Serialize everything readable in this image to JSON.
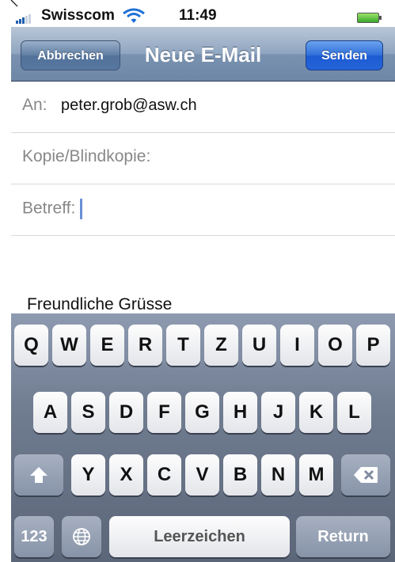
{
  "status_bar": {
    "carrier": "Swisscom",
    "time": "11:49"
  },
  "nav": {
    "title": "Neue E-Mail",
    "cancel_label": "Abbrechen",
    "send_label": "Senden"
  },
  "compose": {
    "to_label": "An:",
    "to_value": "peter.grob@asw.ch",
    "cc_label": "Kopie/Blindkopie:",
    "subject_label": "Betreff:",
    "subject_value": "",
    "body": "Freundliche Grüsse"
  },
  "keyboard": {
    "row1": [
      "Q",
      "W",
      "E",
      "R",
      "T",
      "Z",
      "U",
      "I",
      "O",
      "P"
    ],
    "row2": [
      "A",
      "S",
      "D",
      "F",
      "G",
      "H",
      "J",
      "K",
      "L"
    ],
    "row3": [
      "Y",
      "X",
      "C",
      "V",
      "B",
      "N",
      "M"
    ],
    "numbers_label": "123",
    "space_label": "Leerzeichen",
    "return_label": "Return"
  },
  "colors": {
    "send_button": "#2563d9",
    "nav_bar": "#7a92b0",
    "keyboard_bg": "#6f7b8f"
  }
}
